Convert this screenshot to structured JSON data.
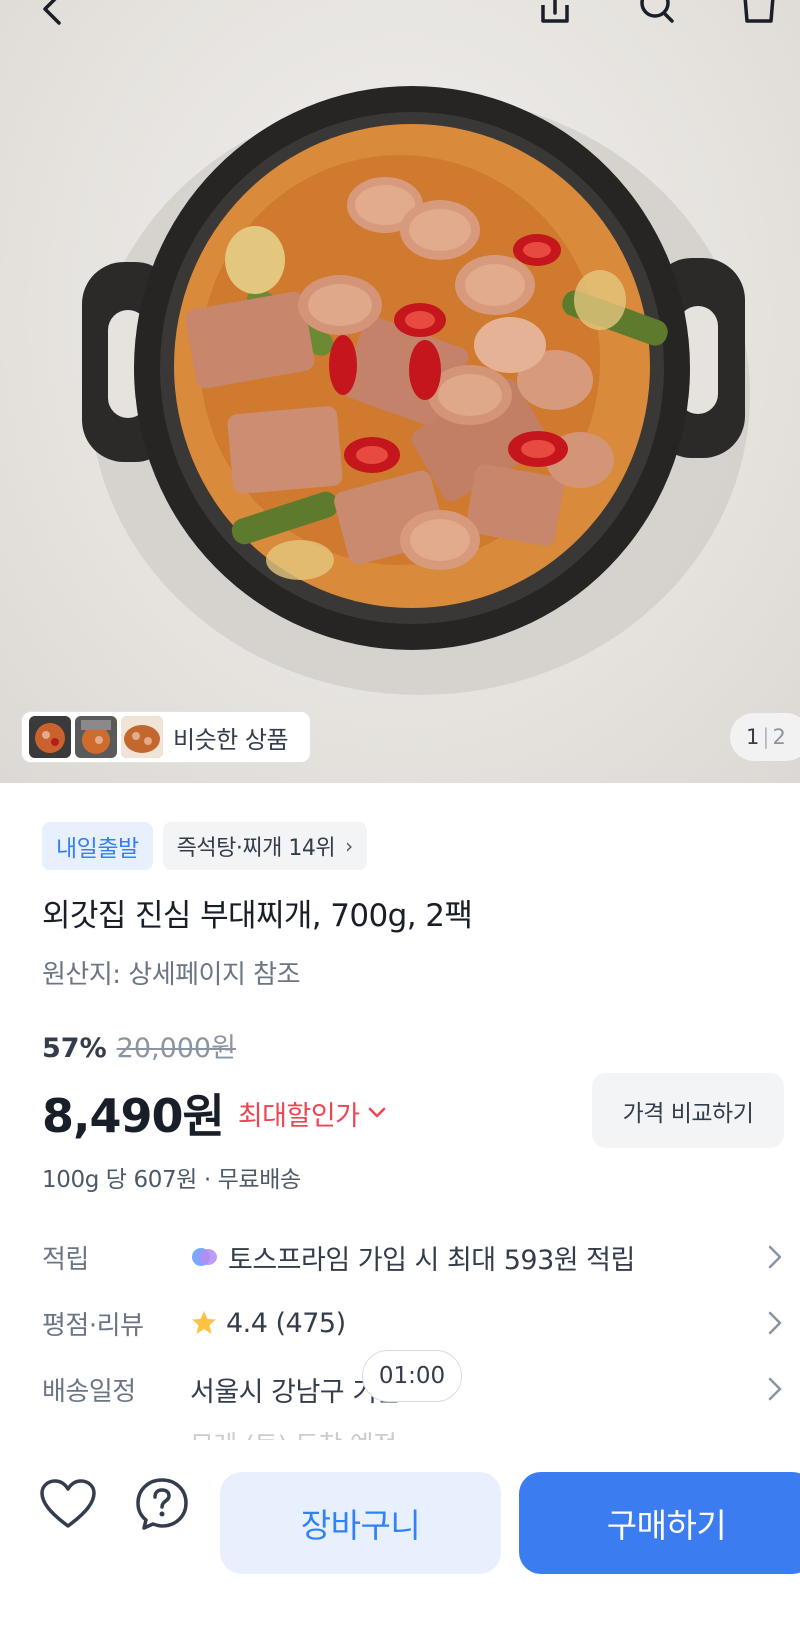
{
  "nav": {
    "back_icon": "back-icon",
    "share_icon": "share-icon",
    "search_icon": "search-icon",
    "cart_icon": "cart-icon"
  },
  "gallery": {
    "similar_label": "비슷한 상품",
    "current_page": "1",
    "total_pages": "2"
  },
  "product": {
    "badge_shipping": "내일출발",
    "badge_rank": "즉석탕·찌개 14위",
    "title": "외갓집 진심 부대찌개, 700g, 2팩",
    "origin": "원산지: 상세페이지 참조",
    "discount_rate": "57%",
    "original_price": "20,000원",
    "price": "8,490원",
    "max_discount_label": "최대할인가",
    "compare_button": "가격 비교하기",
    "unit_price": "100g 당 607원 · 무료배송"
  },
  "details": {
    "points_key": "적립",
    "points_value": "토스프라임 가입 시 최대 593원 적립",
    "rating_key": "평점·리뷰",
    "rating_value": "4.4 (475)",
    "delivery_key": "배송일정",
    "delivery_value": "서울시 강남구 기준",
    "delivery_sub": "모레 (토) 도착 예정",
    "timer": "01:00"
  },
  "bottom": {
    "wishlist_icon": "heart-icon",
    "inquiry_icon": "question-icon",
    "cart_button": "장바구니",
    "buy_button": "구매하기"
  },
  "colors": {
    "accent_blue": "#3182f6",
    "discount_red": "#f04452",
    "star_yellow": "#ffc342"
  }
}
